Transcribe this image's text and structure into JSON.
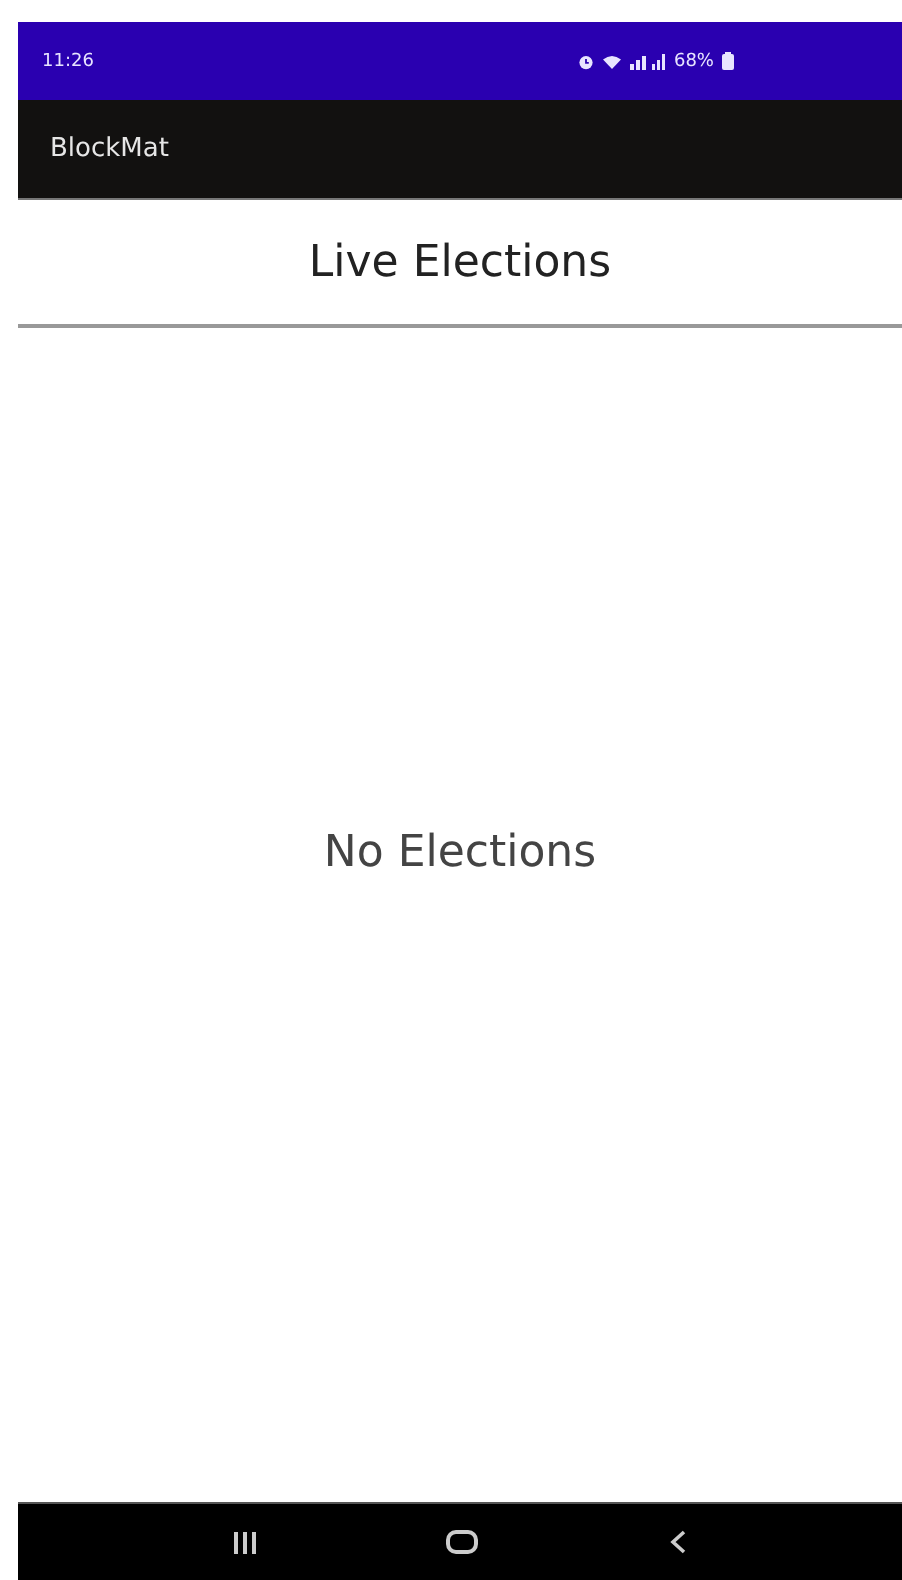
{
  "status_bar": {
    "time": "11:26",
    "battery": "68%"
  },
  "app_bar": {
    "title": "BlockMat"
  },
  "header": {
    "title": "Live Elections"
  },
  "content": {
    "empty_message": "No Elections"
  },
  "nav_bar": {
    "buttons": [
      {
        "kind": "recents"
      },
      {
        "kind": "home"
      },
      {
        "kind": "back"
      }
    ]
  }
}
